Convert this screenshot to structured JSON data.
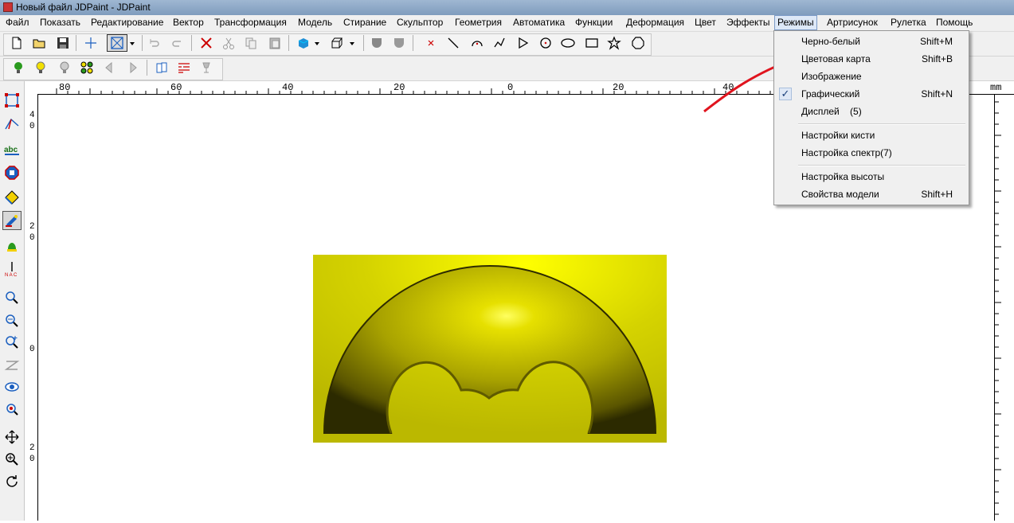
{
  "window": {
    "title": "Новый файл JDPaint - JDPaint"
  },
  "menu": [
    "Файл",
    "Показать",
    "Редактирование",
    "Вектор",
    "Трансформация",
    "Модель",
    "Стирание",
    "Скульптор",
    "Геометрия",
    "Автоматика",
    "Функции",
    "Деформация",
    "Цвет",
    "Эффекты",
    "Режимы",
    "Артрисунок",
    "Рулетка",
    "Помощь"
  ],
  "active_menu": "Режимы",
  "dropdown": {
    "items": [
      {
        "label": "Черно-белый",
        "shortcut": "Shift+M",
        "checked": false
      },
      {
        "label": "Цветовая карта",
        "shortcut": "Shift+B",
        "checked": false
      },
      {
        "label": "Изображение",
        "shortcut": "",
        "checked": false
      },
      {
        "label": "Графический",
        "shortcut": "Shift+N",
        "checked": true
      },
      {
        "label": "Дисплей    (5)",
        "shortcut": "",
        "checked": false
      },
      {
        "label": "Настройки кисти",
        "shortcut": "",
        "checked": false
      },
      {
        "label": "Настройка спектр(7)",
        "shortcut": "",
        "checked": false
      },
      {
        "label": "Настройка высоты",
        "shortcut": "",
        "checked": false
      },
      {
        "label": "Свойства модели",
        "shortcut": "Shift+H",
        "checked": false
      }
    ]
  },
  "ruler": {
    "top_labels": [
      "80",
      "60",
      "40",
      "20",
      "0",
      "20",
      "40"
    ],
    "unit": "mm",
    "left_labels": [
      "40",
      "20",
      "0",
      "20"
    ]
  },
  "colors": {
    "model_yellow": "#d8d800",
    "arrow_red": "#e0141e",
    "menu_highlight": "#dde8f7"
  }
}
